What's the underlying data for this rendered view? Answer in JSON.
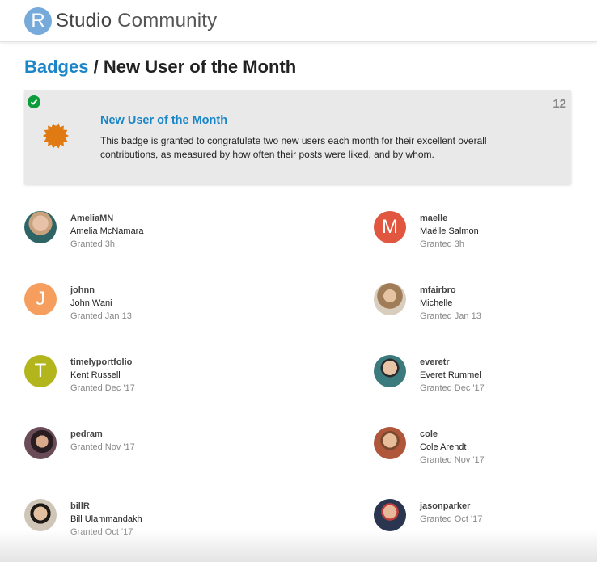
{
  "header": {
    "logo_letter": "R",
    "logo_text_bold": "Studio",
    "logo_text_light": "Community"
  },
  "page": {
    "breadcrumb": "Badges",
    "separator": "/",
    "title": "New User of the Month"
  },
  "badge": {
    "name": "New User of the Month",
    "count": "12",
    "description": "This badge is granted to congratulate two new users each month for their excellent overall contributions, as measured by how often their posts were liked, and by whom.",
    "icon_color": "#e07b14",
    "check_color": "#0c9c3b",
    "icon": "check-circle-icon"
  },
  "users": [
    {
      "username": "AmeliaMN",
      "name": "Amelia McNamara",
      "granted": "Granted 3h",
      "avatar": "photo",
      "color": "#6b8080"
    },
    {
      "username": "maelle",
      "name": "Maëlle Salmon",
      "granted": "Granted 3h",
      "avatar_letter": "M",
      "color": "#e1563e"
    },
    {
      "username": "johnn",
      "name": "John Wani",
      "granted": "Granted Jan 13",
      "avatar_letter": "J",
      "color": "#f59e5d"
    },
    {
      "username": "mfairbro",
      "name": "Michelle",
      "granted": "Granted Jan 13",
      "avatar": "photo",
      "color": "#9a7b5a"
    },
    {
      "username": "timelyportfolio",
      "name": "Kent Russell",
      "granted": "Granted Dec '17",
      "avatar_letter": "T",
      "color": "#b3b51d"
    },
    {
      "username": "everetr",
      "name": "Everet Rummel",
      "granted": "Granted Dec '17",
      "avatar": "photo",
      "color": "#3b7b7e"
    },
    {
      "username": "pedram",
      "name": "",
      "granted": "Granted Nov '17",
      "avatar": "photo",
      "color": "#4a3440"
    },
    {
      "username": "cole",
      "name": "Cole Arendt",
      "granted": "Granted Nov '17",
      "avatar": "photo",
      "color": "#b0563a"
    },
    {
      "username": "billR",
      "name": "Bill Ulammandakh",
      "granted": "Granted Oct '17",
      "avatar": "photo",
      "color": "#c9b69a"
    },
    {
      "username": "jasonparker",
      "name": "",
      "granted": "Granted Oct '17",
      "avatar": "photo",
      "color": "#3a4a6a"
    }
  ]
}
